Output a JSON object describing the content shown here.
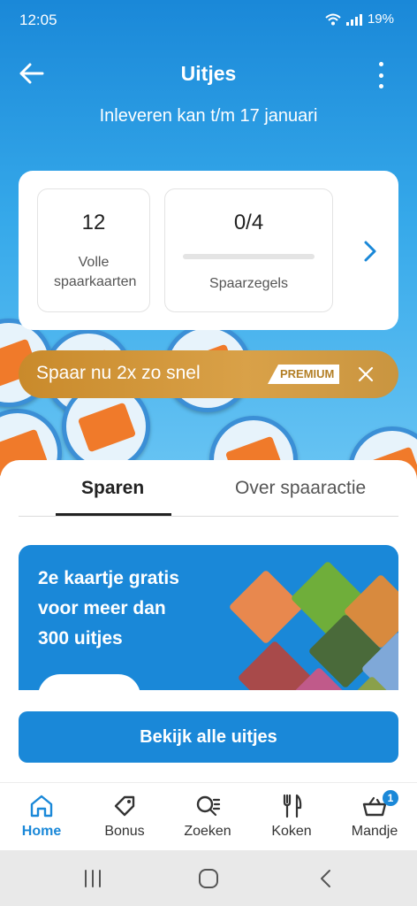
{
  "status": {
    "time": "12:05",
    "battery": "19%"
  },
  "header": {
    "title": "Uitjes",
    "subtitle": "Inleveren kan t/m 17 januari"
  },
  "summary": {
    "full_cards_value": "12",
    "full_cards_label": "Volle spaarkaarten",
    "stamps_value": "0/4",
    "stamps_progress": 0,
    "stamps_label": "Spaarzegels"
  },
  "premium": {
    "text": "Spaar nu 2x zo snel",
    "badge": "PREMIUM"
  },
  "tabs": [
    {
      "label": "Sparen"
    },
    {
      "label": "Over spaaractie"
    }
  ],
  "promo": {
    "lines": [
      "2e kaartje gratis",
      "voor meer dan",
      "300 uitjes"
    ]
  },
  "cta": {
    "label": "Bekijk alle uitjes"
  },
  "nav": [
    {
      "label": "Home",
      "icon": "home-icon"
    },
    {
      "label": "Bonus",
      "icon": "tag-icon"
    },
    {
      "label": "Zoeken",
      "icon": "search-icon"
    },
    {
      "label": "Koken",
      "icon": "fork-knife-icon"
    },
    {
      "label": "Mandje",
      "icon": "basket-icon",
      "badge": "1"
    }
  ],
  "colors": {
    "primary": "#1a88d8",
    "premium": "#d29a3f"
  }
}
